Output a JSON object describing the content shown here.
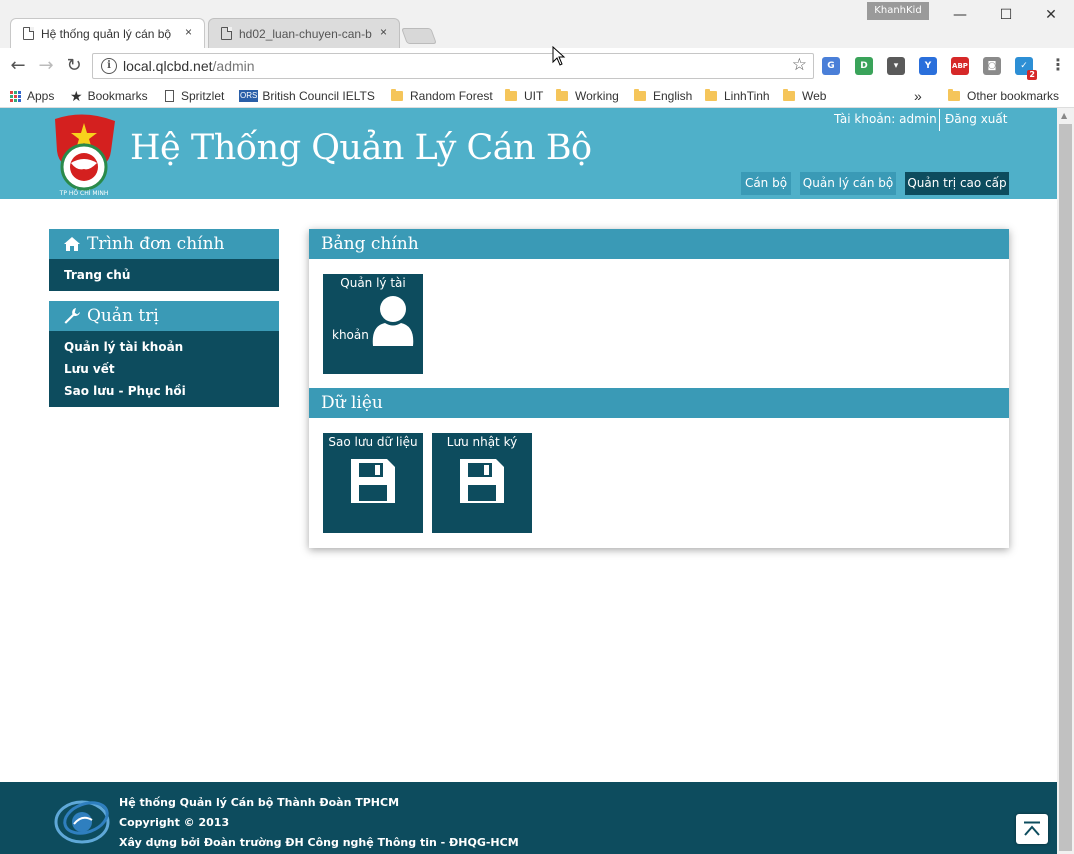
{
  "browser": {
    "profile_name": "KhanhKid",
    "tabs": [
      {
        "title": "Hệ thống quản lý cán bộ",
        "active": true
      },
      {
        "title": "hd02_luan-chuyen-can-b",
        "active": false
      }
    ],
    "tab_close_glyph": "×",
    "address": {
      "host": "local.qlcbd.net",
      "path": "/admin"
    },
    "window_controls": {
      "minimize": "—",
      "maximize": "☐",
      "close": "✕"
    },
    "nav": {
      "back": "←",
      "forward": "→",
      "reload": "↻",
      "star": "☆",
      "menu": "⋮",
      "info": "i"
    },
    "extensions": [
      {
        "name": "translate-icon",
        "label": "G",
        "color": "#4a7fd8"
      },
      {
        "name": "instapaper-icon",
        "label": "D",
        "color": "#3aa35a"
      },
      {
        "name": "pocket-icon",
        "label": "▾",
        "color": "#5a5a5a"
      },
      {
        "name": "vpn-icon",
        "label": "Y",
        "color": "#2a6fdb"
      },
      {
        "name": "adblock-icon",
        "label": "ABP",
        "color": "#d62828"
      },
      {
        "name": "camera-icon",
        "label": "◙",
        "color": "#8a8a8a"
      },
      {
        "name": "todo-icon",
        "label": "✓",
        "color": "#2d8fd5",
        "badge": "2"
      }
    ],
    "bookmarks": [
      {
        "label": "Apps",
        "kind": "apps"
      },
      {
        "label": "Bookmarks",
        "kind": "star"
      },
      {
        "label": "Spritzlet",
        "kind": "page"
      },
      {
        "label": "British Council IELTS C",
        "kind": "ors"
      },
      {
        "label": "Random Forest",
        "kind": "folder"
      },
      {
        "label": "UIT",
        "kind": "folder"
      },
      {
        "label": "Working",
        "kind": "folder"
      },
      {
        "label": "English",
        "kind": "folder"
      },
      {
        "label": "LinhTinh",
        "kind": "folder"
      },
      {
        "label": "Web",
        "kind": "folder"
      }
    ],
    "bookmarks_overflow": "»",
    "other_bookmarks": "Other bookmarks",
    "ors_badge": "ORS"
  },
  "header": {
    "title": "Hệ Thống Quản Lý Cán Bộ",
    "account_label": "Tài khoản: admin",
    "logout_label": "Đăng xuất",
    "logo_caption": "TP HỒ CHÍ MINH",
    "nav": [
      {
        "label": "Cán bộ",
        "active": false
      },
      {
        "label": "Quản lý cán bộ",
        "active": false
      },
      {
        "label": "Quản trị cao cấp",
        "active": true
      }
    ]
  },
  "sidebar": {
    "main_menu": {
      "title": "Trình đơn chính",
      "icon": "home-icon",
      "items": [
        "Trang chủ"
      ]
    },
    "admin_menu": {
      "title": "Quản trị",
      "icon": "wrench-icon",
      "items": [
        "Quản lý tài khoản",
        "Lưu vết",
        "Sao lưu - Phục hồi"
      ]
    }
  },
  "main": {
    "sections": [
      {
        "title": "Bảng chính",
        "tiles": [
          {
            "label_line1": "Quản lý tài",
            "label_line2": "khoản",
            "icon": "user-icon"
          }
        ]
      },
      {
        "title": "Dữ liệu",
        "tiles": [
          {
            "label": "Sao lưu dữ liệu",
            "icon": "floppy-disk-icon"
          },
          {
            "label": "Lưu nhật ký",
            "icon": "floppy-disk-icon"
          }
        ]
      }
    ]
  },
  "footer": {
    "lines": [
      "Hệ thống Quản lý Cán bộ Thành Đoàn TPHCM",
      "Copyright © 2013",
      "Xây dựng bởi Đoàn trường ĐH Công nghệ Thông tin - ĐHQG-HCM"
    ]
  },
  "colors": {
    "header": "#4fb0c9",
    "section_head": "#3a9ab6",
    "dark_teal": "#0d4c5e"
  }
}
